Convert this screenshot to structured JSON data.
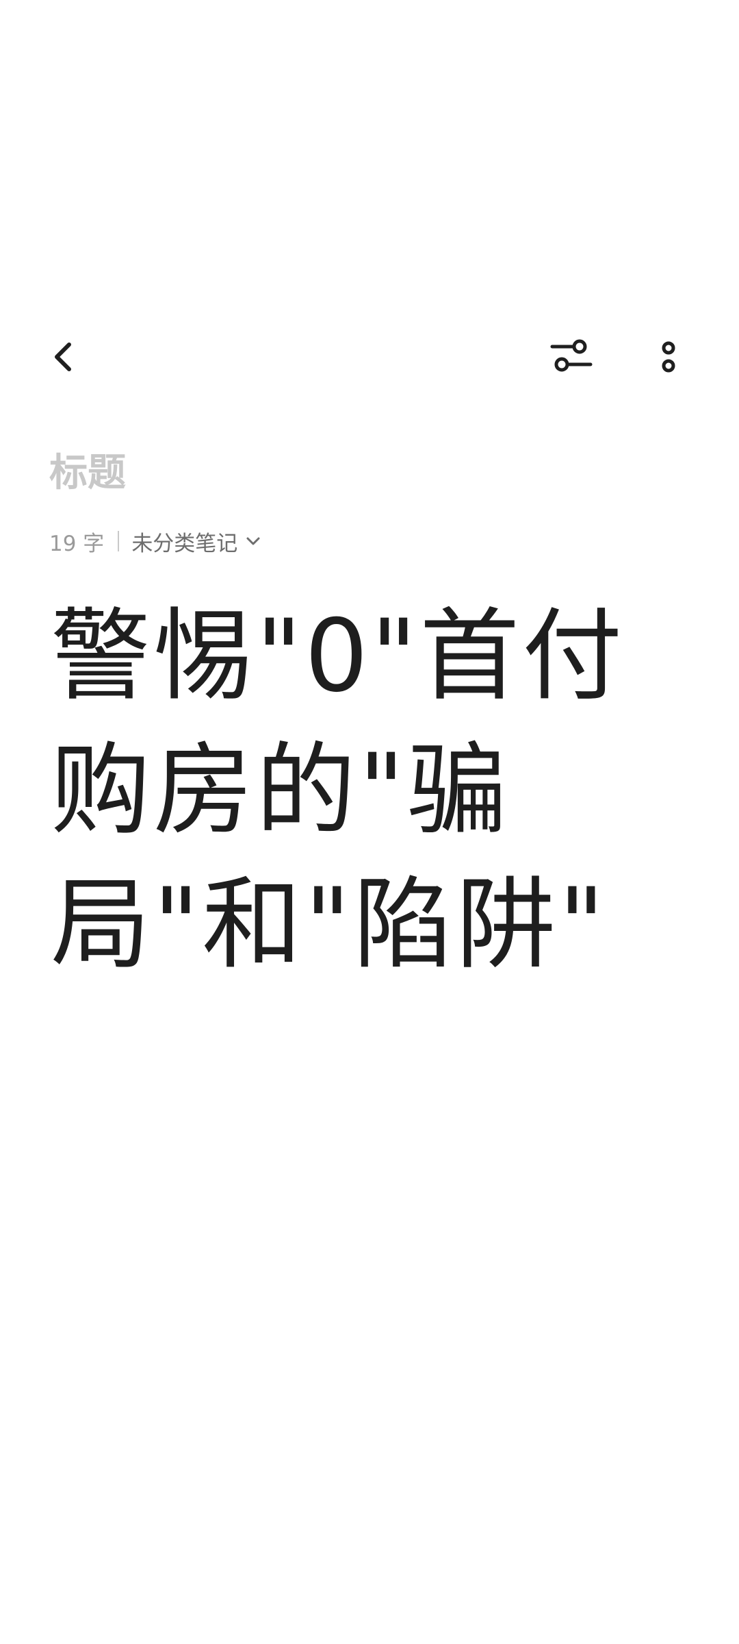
{
  "toolbar": {
    "back_icon": "chevron-left-icon",
    "format_icon": "text-format-icon",
    "more_icon": "more-vertical-icon"
  },
  "note": {
    "title_value": "",
    "title_placeholder": "标题",
    "word_count": "19 字",
    "category": "未分类笔记",
    "category_icon": "chevron-down-icon",
    "body": "警惕\"0\"首付购房的\"骗局\"和\"陷阱\""
  }
}
